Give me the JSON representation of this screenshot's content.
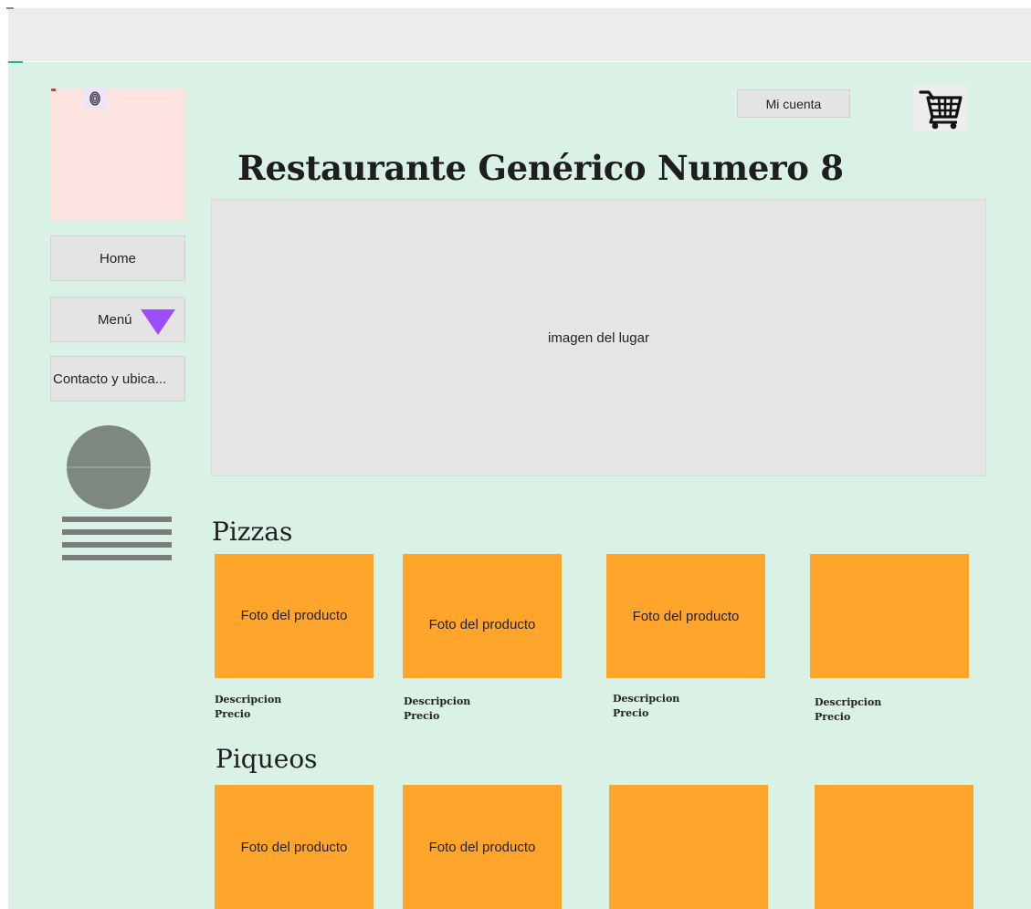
{
  "header": {
    "account_label": "Mi cuenta",
    "cart_icon": "cart-icon"
  },
  "sidebar": {
    "logo_icon": "fingerprint-icon",
    "nav": [
      {
        "label": "Home"
      },
      {
        "label": "Menú",
        "icon": "triangle-down-icon"
      },
      {
        "label": "Contacto y ubica..."
      }
    ],
    "user_icon": "user-avatar-icon"
  },
  "main": {
    "title": "Restaurante Genérico Numero 8",
    "hero_label": "imagen del lugar",
    "sections": [
      {
        "title": "Pizzas",
        "products": [
          {
            "photo": "Foto del producto",
            "description": "Descripcion",
            "price": "Precio"
          },
          {
            "photo": "Foto del producto",
            "description": "Descripcion",
            "price": "Precio"
          },
          {
            "photo": "Foto del producto",
            "description": "Descripcion",
            "price": "Precio"
          },
          {
            "photo": "",
            "description": "Descripcion",
            "price": "Precio"
          }
        ]
      },
      {
        "title": "Piqueos",
        "products": [
          {
            "photo": "Foto del producto"
          },
          {
            "photo": "Foto del producto"
          },
          {
            "photo": ""
          },
          {
            "photo": ""
          }
        ]
      }
    ]
  },
  "colors": {
    "canvas": "#daf1e6",
    "topbar": "#ececec",
    "product_card": "#ffa52b",
    "logo_box": "#fde3df",
    "menu_arrow": "#9b4dff",
    "avatar": "#7f8880"
  }
}
